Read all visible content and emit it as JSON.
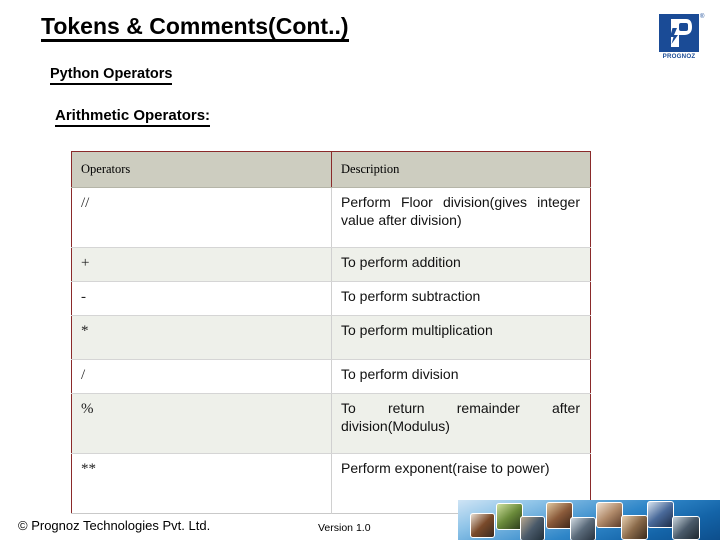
{
  "slide": {
    "title": "Tokens & Comments(Cont..)",
    "sub_heading_1": "Python Operators",
    "sub_heading_2": "Arithmetic Operators:"
  },
  "logo": {
    "name": "prognoz-logo",
    "wordmark": "PROGNOZ",
    "registered_mark": "®",
    "letter": "P",
    "brand_color": "#1a4b96"
  },
  "table": {
    "headers": [
      "Operators",
      "Description"
    ],
    "header_bg": "#cdcdc0",
    "border_color": "#8a2a2a",
    "alt_row_bg": "#eef0ea",
    "rows": [
      {
        "operator": "//",
        "description": "Perform Floor division(gives integer value after division)"
      },
      {
        "operator": "+",
        "description": "To perform addition"
      },
      {
        "operator": "-",
        "description": "To perform subtraction"
      },
      {
        "operator": "*",
        "description": "To perform multiplication"
      },
      {
        "operator": "/",
        "description": "To perform division"
      },
      {
        "operator": "%",
        "description": "To return remainder after division(Modulus)"
      },
      {
        "operator": "**",
        "description": "Perform exponent(raise to power)"
      }
    ]
  },
  "footer": {
    "copyright": "© Prognoz Technologies Pvt. Ltd.",
    "version": "Version 1.0"
  }
}
